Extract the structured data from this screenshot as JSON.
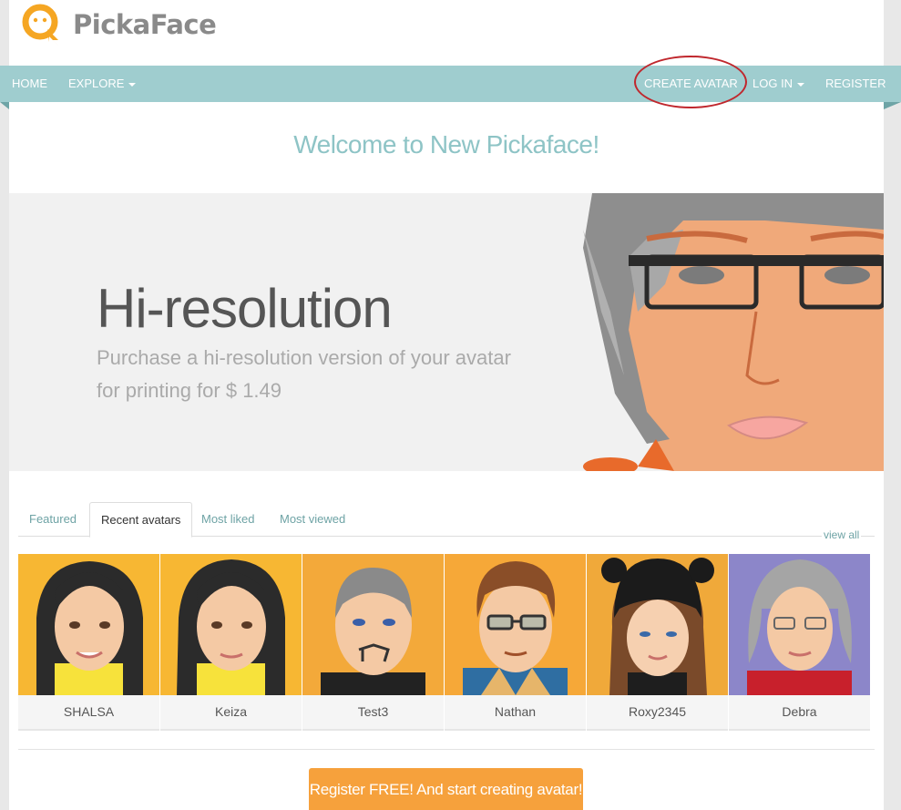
{
  "brand": {
    "name": "PickaFace",
    "accent": "#f5a623",
    "nav_color": "#9fcdcf"
  },
  "nav": {
    "home": "HOME",
    "explore": "EXPLORE",
    "create_avatar": "CREATE AVATAR",
    "log_in": "LOG IN",
    "register": "REGISTER"
  },
  "welcome": "Welcome to New Pickaface!",
  "hero": {
    "title": "Hi-resolution",
    "line1": "Purchase a hi-resolution version of your avatar",
    "line2": "for printing for $ 1.49"
  },
  "tabs": [
    "Featured",
    "Recent avatars",
    "Most liked",
    "Most viewed"
  ],
  "active_tab": "Recent avatars",
  "view_all": "view all",
  "avatars": [
    {
      "name": "SHALSA",
      "bg": "#f7b733"
    },
    {
      "name": "Keiza",
      "bg": "#f7b733"
    },
    {
      "name": "Test3",
      "bg": "#f3a93a"
    },
    {
      "name": "Nathan",
      "bg": "#f6a838"
    },
    {
      "name": "Roxy2345",
      "bg": "#f0a93a"
    },
    {
      "name": "Debra",
      "bg": "#8c86c9"
    }
  ],
  "cta": "Register FREE! And start creating avatar!"
}
